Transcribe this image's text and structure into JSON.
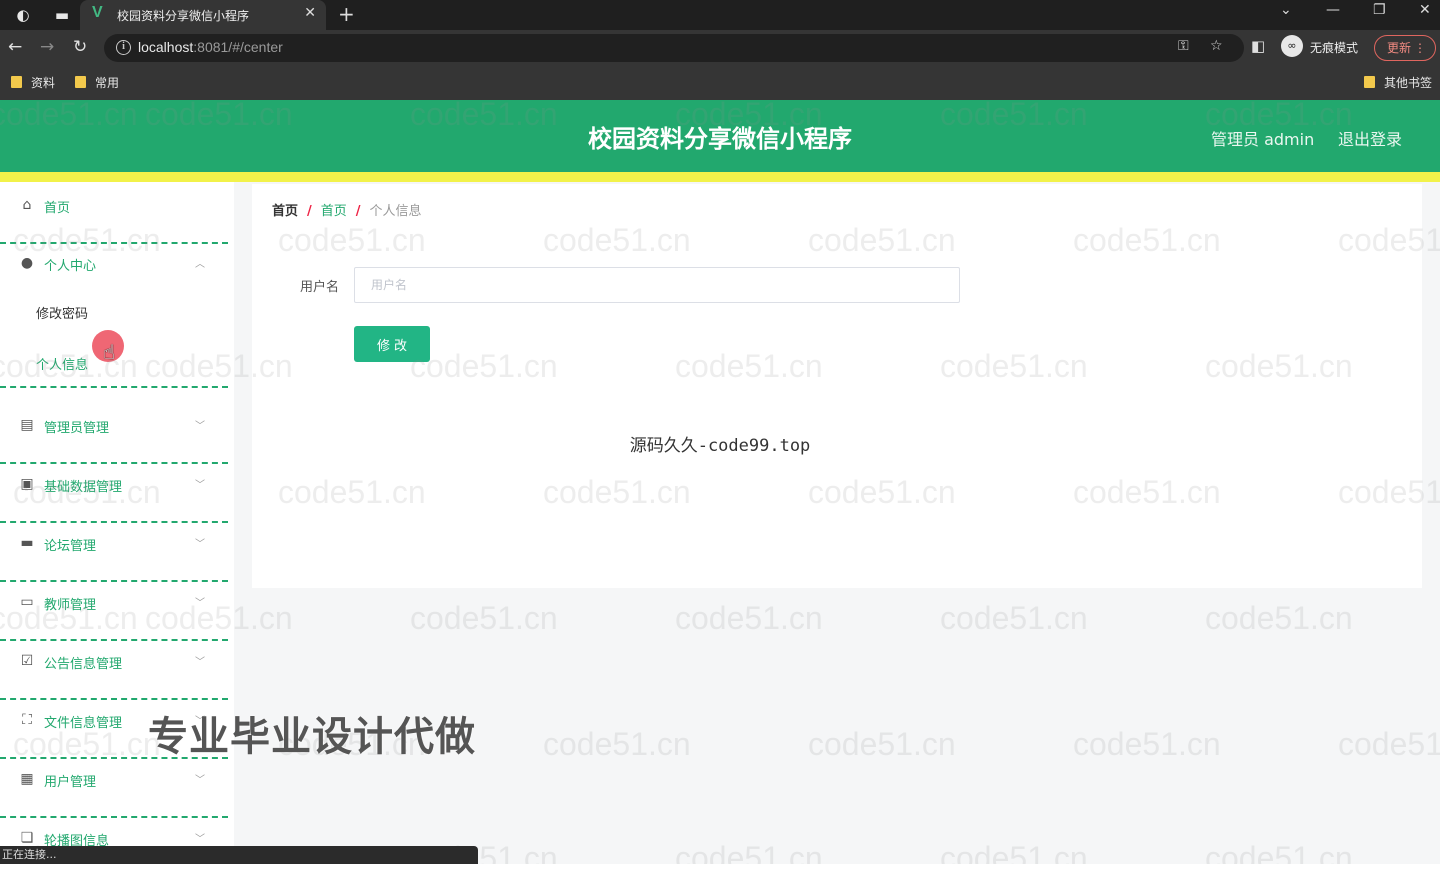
{
  "browser": {
    "tab_title": "校园资料分享微信小程序",
    "url_host": "localhost",
    "url_rest": ":8081/#/center",
    "incognito_label": "无痕模式",
    "update_label": "更新",
    "bookmarks": [
      "资料",
      "常用"
    ],
    "other_bookmarks": "其他书签",
    "status_text": "正在连接..."
  },
  "header": {
    "title": "校园资料分享微信小程序",
    "admin_label": "管理员 admin",
    "logout_label": "退出登录"
  },
  "sidebar": {
    "home": "首页",
    "personal_center": "个人中心",
    "sub_change_password": "修改密码",
    "sub_personal_info": "个人信息",
    "admin_mgmt": "管理员管理",
    "basic_data_mgmt": "基础数据管理",
    "forum_mgmt": "论坛管理",
    "teacher_mgmt": "教师管理",
    "notice_mgmt": "公告信息管理",
    "file_mgmt": "文件信息管理",
    "user_mgmt": "用户管理",
    "carousel_info": "轮播图信息"
  },
  "breadcrumb": {
    "home": "首页",
    "mid": "首页",
    "current": "个人信息"
  },
  "form": {
    "username_label": "用户名",
    "username_placeholder": "用户名",
    "username_value": "",
    "submit_label": "修改"
  },
  "overlays": {
    "watermark": "code51.cn",
    "center_caption": "源码久久-code99.top",
    "promo_text": "专业毕业设计代做"
  },
  "colors": {
    "brand_green": "#22a86e",
    "button_green": "#22b585",
    "accent_yellow": "#f2f24a",
    "breadcrumb_sep": "#ee2244"
  }
}
